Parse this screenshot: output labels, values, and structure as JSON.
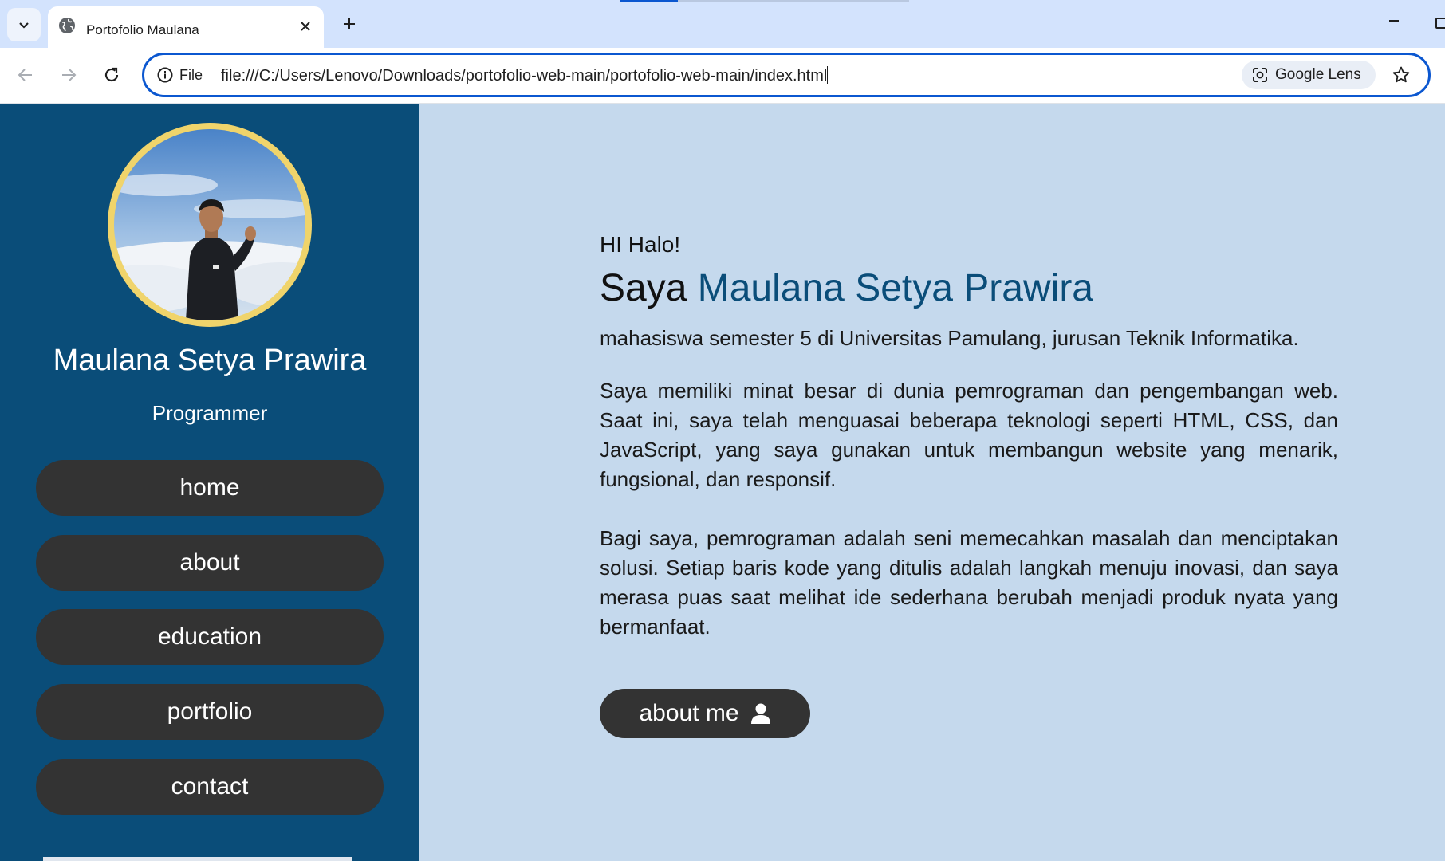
{
  "browser": {
    "tab_title": "Portofolio Maulana",
    "scheme_label": "File",
    "url": "file:///C:/Users/Lenovo/Downloads/portofolio-web-main/portofolio-web-main/index.html",
    "lens_label": "Google Lens"
  },
  "sidebar": {
    "name": "Maulana Setya Prawira",
    "role": "Programmer",
    "nav": [
      {
        "label": "home"
      },
      {
        "label": "about"
      },
      {
        "label": "education"
      },
      {
        "label": "portfolio"
      },
      {
        "label": "contact"
      }
    ]
  },
  "hero": {
    "greeting": "HI Halo!",
    "headline_prefix": "Saya",
    "headline_name": "Maulana Setya Prawira",
    "paragraphs": [
      "mahasiswa semester 5 di Universitas Pamulang, jurusan Teknik Informatika.",
      "Saya memiliki minat besar di dunia pemrograman dan pengembangan web. Saat ini, saya telah menguasai beberapa teknologi seperti HTML, CSS, dan JavaScript, yang saya gunakan untuk membangun website yang menarik, fungsional, dan responsif.",
      "Bagi saya, pemrograman adalah seni memecahkan masalah dan menciptakan solusi. Setiap baris kode yang ditulis adalah langkah menuju inovasi, dan saya merasa puas saat melihat ide sederhana berubah menjadi produk nyata yang bermanfaat."
    ],
    "cta_label": "about me"
  },
  "colors": {
    "sidebar_bg": "#0a4d79",
    "main_bg": "#c5d9ed",
    "button_bg": "#333333",
    "accent_name": "#0a4d79",
    "avatar_ring": "#f0d46b"
  },
  "icons": [
    "chevron-down-icon",
    "globe-icon",
    "close-icon",
    "plus-icon",
    "minimize-icon",
    "maximize-icon",
    "back-arrow-icon",
    "forward-arrow-icon",
    "reload-icon",
    "info-icon",
    "lens-icon",
    "star-icon",
    "user-icon"
  ]
}
